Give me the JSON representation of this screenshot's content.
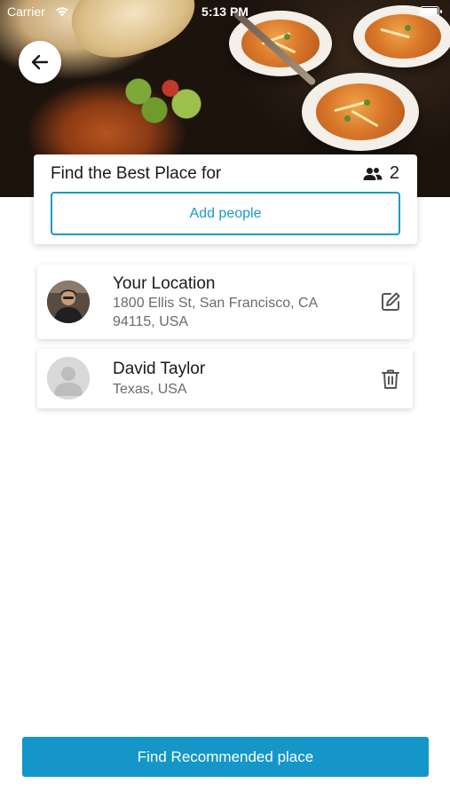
{
  "status_bar": {
    "carrier": "Carrier",
    "time": "5:13 PM"
  },
  "header": {
    "back_icon": "arrow-left-icon"
  },
  "group": {
    "title": "Find the Best Place for",
    "people_icon": "people-icon",
    "count": "2",
    "add_people_label": "Add people"
  },
  "people": [
    {
      "name": "Your Location",
      "address": "1800 Ellis St, San Francisco, CA 94115, USA",
      "avatar": "user-photo",
      "action_icon": "edit-icon"
    },
    {
      "name": "David Taylor",
      "address": "Texas, USA",
      "avatar": "default-avatar-icon",
      "action_icon": "trash-icon"
    }
  ],
  "footer": {
    "find_label": "Find Recommended place"
  },
  "colors": {
    "accent": "#1496c9",
    "outline_accent": "#1a9ac9",
    "text_primary": "#1a1a1a",
    "text_secondary": "#6b6b6b"
  }
}
